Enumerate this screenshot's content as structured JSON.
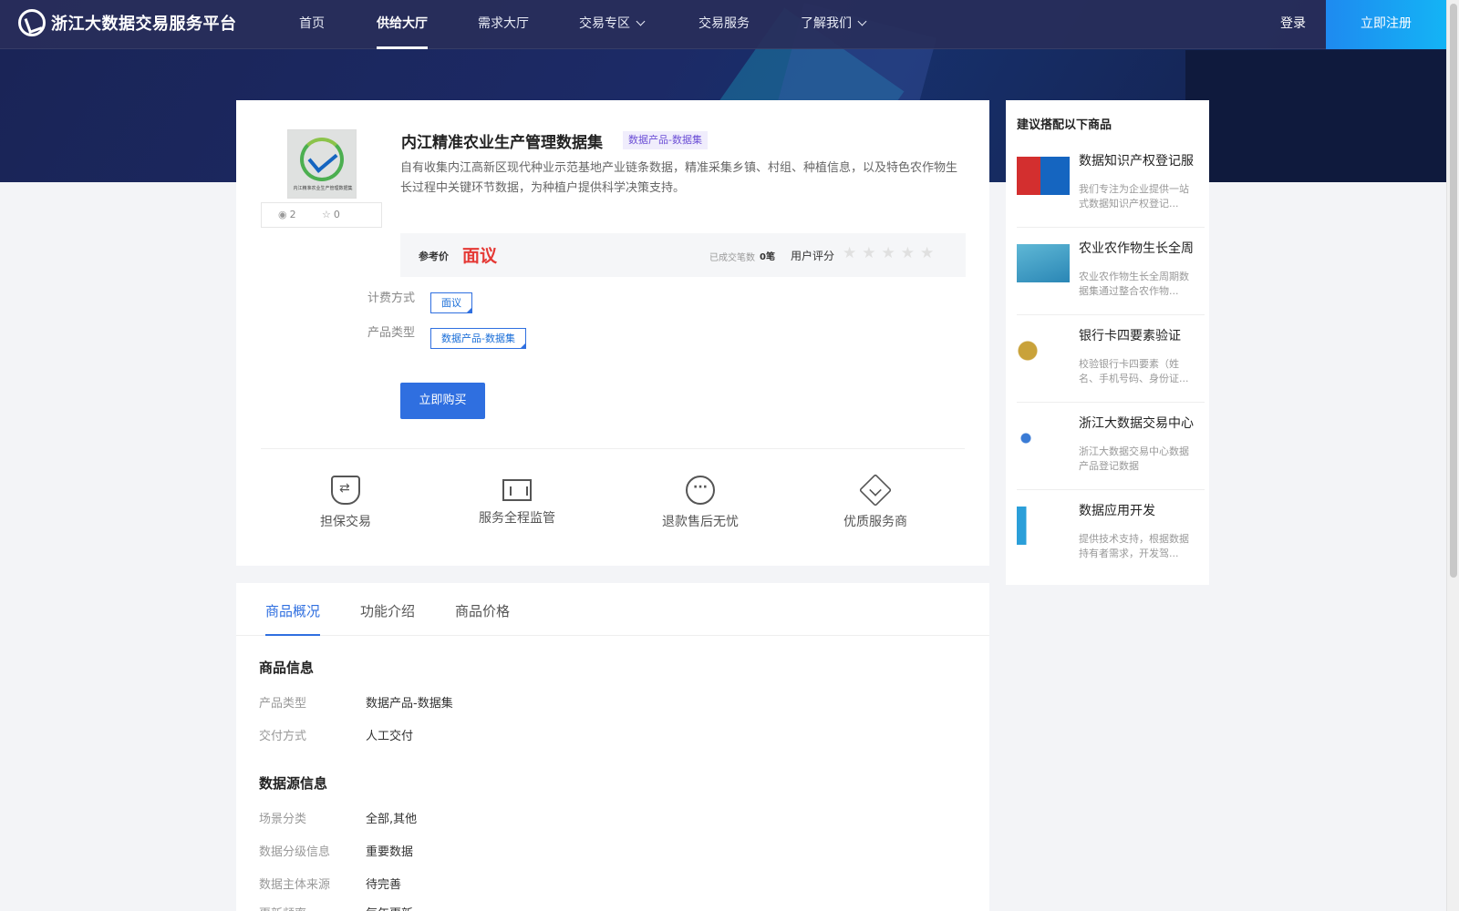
{
  "header": {
    "logo_text": "浙江大数据交易服务平台",
    "nav": [
      "首页",
      "供给大厅",
      "需求大厅",
      "交易专区",
      "交易服务",
      "了解我们"
    ],
    "login": "登录",
    "register": "立即注册"
  },
  "product": {
    "thumb_caption": "内江精准农业生产管理数据集",
    "views": "2",
    "favorites": "0",
    "title": "内江精准农业生产管理数据集",
    "tag": "数据产品-数据集",
    "description": "自有收集内江高新区现代种业示范基地产业链条数据，精准采集乡镇、村组、种植信息，以及特色农作物生长过程中关键环节数据，为种植户提供科学决策支持。",
    "price_label": "参考价",
    "price_value": "面议",
    "trade_count_label": "已成交笔数",
    "trade_count_value": "0笔",
    "rating_label": "用户评分",
    "rating_stars": "★★★★★",
    "billing_label": "计费方式",
    "billing_value": "面议",
    "type_label": "产品类型",
    "type_value": "数据产品-数据集",
    "buy_button": "立即购买"
  },
  "features": [
    {
      "label": "担保交易",
      "icon": "shield-exchange-icon"
    },
    {
      "label": "服务全程监管",
      "icon": "monitor-chart-icon"
    },
    {
      "label": "退款售后无忧",
      "icon": "chat-bubble-icon"
    },
    {
      "label": "优质服务商",
      "icon": "diamond-icon"
    }
  ],
  "side": {
    "title": "建议搭配以下商品",
    "items": [
      {
        "name": "数据知识产权登记服",
        "desc": "我们专注为企业提供一站式数据知识产权登记..."
      },
      {
        "name": "农业农作物生长全周",
        "desc": "农业农作物生长全周期数据集通过整合农作物..."
      },
      {
        "name": "银行卡四要素验证",
        "desc": "校验银行卡四要素（姓名、手机号码、身份证..."
      },
      {
        "name": "浙江大数据交易中心",
        "desc": "浙江大数据交易中心数据产品登记数据"
      },
      {
        "name": "数据应用开发",
        "desc": "提供技术支持，根据数据持有者需求，开发驾..."
      }
    ]
  },
  "tabs": [
    "商品概况",
    "功能介绍",
    "商品价格"
  ],
  "info": {
    "section1_title": "商品信息",
    "rows1": [
      {
        "label": "产品类型",
        "value": "数据产品-数据集"
      },
      {
        "label": "交付方式",
        "value": "人工交付"
      }
    ],
    "section2_title": "数据源信息",
    "rows2": [
      {
        "label": "场景分类",
        "value": "全部,其他"
      },
      {
        "label": "数据分级信息",
        "value": "重要数据"
      },
      {
        "label": "数据主体来源",
        "value": "待完善"
      },
      {
        "label": "更新频率",
        "value": "每年更新"
      }
    ]
  },
  "colors": {
    "accent": "#2f6fe0",
    "price": "#e53935",
    "tag_text": "#6c4fd6"
  }
}
